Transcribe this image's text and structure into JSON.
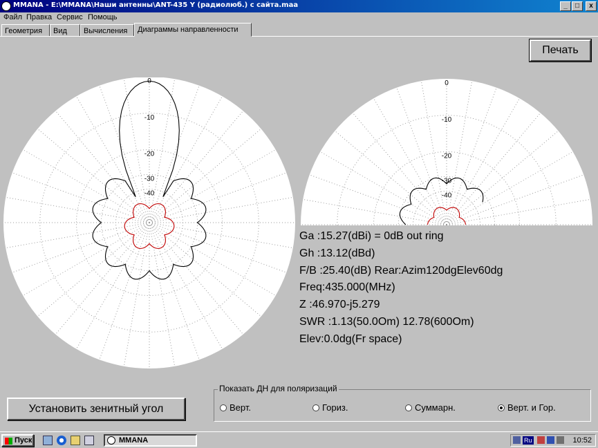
{
  "window": {
    "title": "MMANA - E:\\MMANA\\Наши антенны\\ANT-435 Y (радиолюб.) с сайта.maa",
    "minimize": "_",
    "maximize": "□",
    "close": "x"
  },
  "menu": {
    "file": "Файл",
    "edit": "Правка",
    "service": "Сервис",
    "help": "Помощь"
  },
  "tabs": [
    "Геометрия",
    "Вид",
    "Вычисления",
    "Диаграммы направленности"
  ],
  "buttons": {
    "print": "Печать",
    "zenith": "Установить зенитный угол"
  },
  "plots": {
    "ring_labels": [
      "0",
      "-10",
      "-20",
      "-30",
      "-40"
    ],
    "colors": {
      "hpol": "#000000",
      "vpol": "#c00000",
      "grid": "#9a9a9a"
    }
  },
  "info": {
    "ga": "Ga  :15.27(dBi) = 0dB  out ring",
    "gh": "Gh  :13.12(dBd)",
    "fb": "F/B :25.40(dB) Rear:Azim120dgElev60dg",
    "freq": "Freq:435.000(MHz)",
    "z": "Z   :46.970-j5.279",
    "swr": "SWR :1.13(50.0Om) 12.78(600Om)",
    "elev": "Elev:0.0dg(Fr space)"
  },
  "polarization": {
    "legend": "Показать ДН для поляризаций",
    "options": [
      "Верт.",
      "Гориз.",
      "Суммарн.",
      "Верт. и Гор."
    ],
    "selected": "Верт. и Гор."
  },
  "taskbar": {
    "start": "Пуск",
    "task": "MMANA",
    "lang": "Ru",
    "clock": "10:52"
  }
}
